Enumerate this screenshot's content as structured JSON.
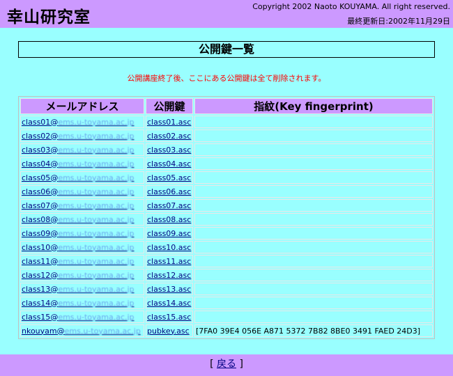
{
  "header": {
    "title": "幸山研究室",
    "copyright": "Copyright 2002 Naoto KOUYAMA. All right reserved.",
    "updated": "最終更新日:2002年11月29日"
  },
  "page_title": "公開鍵一覧",
  "notice": "公開講座終了後、ここにある公開鍵は全て削除されます。",
  "table": {
    "headers": [
      "メールアドレス",
      "公開鍵",
      "指紋(Key fingerprint)"
    ],
    "email_domain": "ems.u-toyama.ac.jp",
    "rows": [
      {
        "user": "class01",
        "key": "class01.asc",
        "fp": ""
      },
      {
        "user": "class02",
        "key": "class02.asc",
        "fp": ""
      },
      {
        "user": "class03",
        "key": "class03.asc",
        "fp": ""
      },
      {
        "user": "class04",
        "key": "class04.asc",
        "fp": ""
      },
      {
        "user": "class05",
        "key": "class05.asc",
        "fp": ""
      },
      {
        "user": "class06",
        "key": "class06.asc",
        "fp": ""
      },
      {
        "user": "class07",
        "key": "class07.asc",
        "fp": ""
      },
      {
        "user": "class08",
        "key": "class08.asc",
        "fp": ""
      },
      {
        "user": "class09",
        "key": "class09.asc",
        "fp": ""
      },
      {
        "user": "class10",
        "key": "class10.asc",
        "fp": ""
      },
      {
        "user": "class11",
        "key": "class11.asc",
        "fp": ""
      },
      {
        "user": "class12",
        "key": "class12.asc",
        "fp": ""
      },
      {
        "user": "class13",
        "key": "class13.asc",
        "fp": ""
      },
      {
        "user": "class14",
        "key": "class14.asc",
        "fp": ""
      },
      {
        "user": "class15",
        "key": "class15.asc",
        "fp": ""
      },
      {
        "user": "nkouyam",
        "key": "pubkey.asc",
        "fp": "[7FA0 39E4 056E A871 5372 7B82 8BE0 3491 FAED 24D3]"
      }
    ]
  },
  "footer": {
    "open_bracket": "[",
    "back_label": "戻る",
    "close_bracket": "]"
  },
  "colors": {
    "background": "#99ffff",
    "header_bar": "#cc99ff",
    "notice_text": "#ff0000",
    "link": "#000080"
  }
}
